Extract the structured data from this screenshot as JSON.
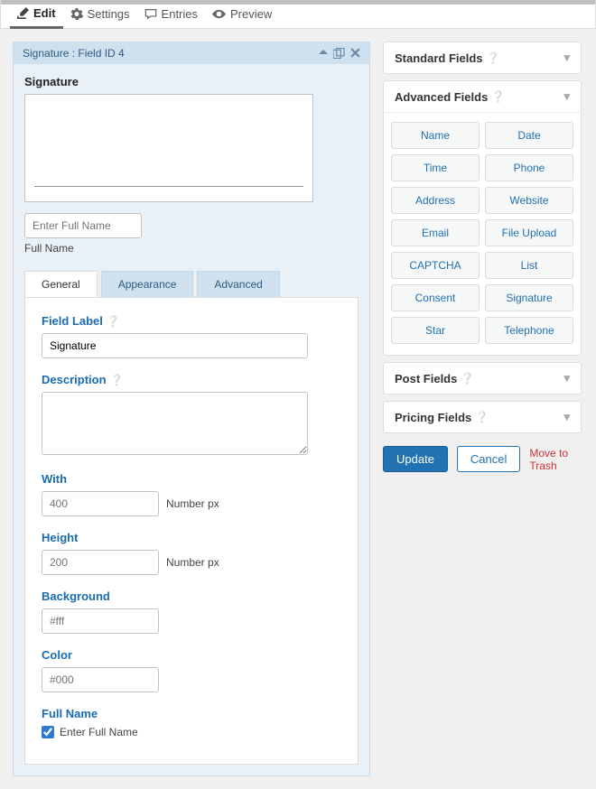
{
  "top_tabs": {
    "edit": "Edit",
    "settings": "Settings",
    "entries": "Entries",
    "preview": "Preview"
  },
  "field_header": {
    "title": "Signature : Field ID 4"
  },
  "preview": {
    "label": "Signature",
    "name_placeholder": "Enter Full Name",
    "sub_label": "Full Name"
  },
  "inner_tabs": {
    "general": "General",
    "appearance": "Appearance",
    "advanced": "Advanced"
  },
  "form": {
    "field_label": {
      "label": "Field Label",
      "value": "Signature"
    },
    "description": {
      "label": "Description",
      "value": ""
    },
    "width": {
      "label": "With",
      "placeholder": "400",
      "unit": "Number px"
    },
    "height": {
      "label": "Height",
      "placeholder": "200",
      "unit": "Number px"
    },
    "background": {
      "label": "Background",
      "placeholder": "#fff"
    },
    "color": {
      "label": "Color",
      "placeholder": "#000"
    },
    "full_name": {
      "label": "Full Name",
      "checkbox": "Enter Full Name"
    }
  },
  "right": {
    "standard": {
      "title": "Standard Fields"
    },
    "advanced": {
      "title": "Advanced Fields",
      "items": [
        "Name",
        "Date",
        "Time",
        "Phone",
        "Address",
        "Website",
        "Email",
        "File Upload",
        "CAPTCHA",
        "List",
        "Consent",
        "Signature",
        "Star",
        "Telephone"
      ]
    },
    "post": {
      "title": "Post Fields"
    },
    "pricing": {
      "title": "Pricing Fields"
    }
  },
  "actions": {
    "update": "Update",
    "cancel": "Cancel",
    "trash": "Move to Trash"
  }
}
